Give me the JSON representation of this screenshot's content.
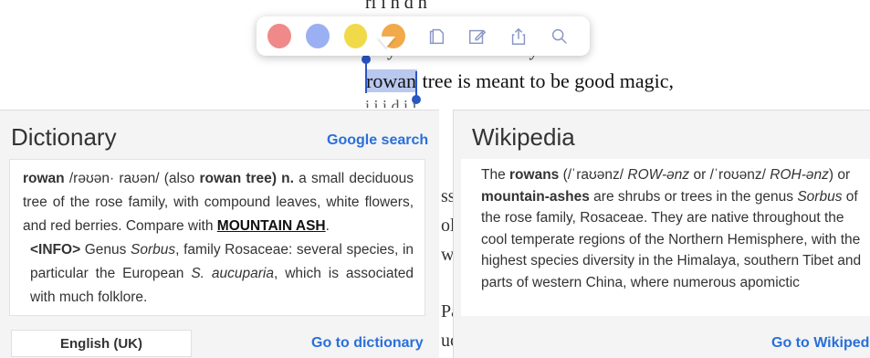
{
  "book": {
    "line_top_partial": "ri   i  h  d h",
    "line_1": "y mother used to say t",
    "line_2_selected": "rowan",
    "line_2_rest": " tree is meant to be good magic,",
    "line_3_partial": "i   i    i    d    i   i   "
  },
  "toolbar": {
    "colors": {
      "red": "#f08a8a",
      "blue": "#9ab0f2",
      "yellow": "#f1da4a",
      "orange": "#f2a94a"
    },
    "icons": [
      "copy-icon",
      "note-icon",
      "share-icon",
      "search-icon"
    ]
  },
  "gap_text": [
    "ss",
    "ol",
    "wo",
    "Pa",
    "uc"
  ],
  "dictionary": {
    "title": "Dictionary",
    "google_link": "Google search",
    "headword": "rowan",
    "pron": " /rəʊən· raʊən/ (also ",
    "variant": "rowan tree",
    "pos": ") n.",
    "definition": " a small deciduous tree of the rose family, with compound leaves, white flowers, and red berries. Compare with ",
    "xref": "MOUNTAIN ASH",
    "xref_after": ".",
    "info_label": "<INFO>",
    "info_text_1": " Genus ",
    "info_genus": "Sorbus",
    "info_text_2": ", family Rosaceae: several species, in particular the European ",
    "info_species": "S. aucuparia",
    "info_text_3": ", which is associated with much folklore.",
    "language": "English (UK)",
    "go_link": "Go to dictionary"
  },
  "wikipedia": {
    "title": "Wikipedia",
    "t1": "The ",
    "b1": "rowans",
    "t2": " (/ˈraʊənz/ ",
    "i1": "ROW-ənz",
    "t3": " or /ˈroʊənz/ ",
    "i2": "ROH-ənz",
    "t4": ") or ",
    "b2": "mountain-ashes",
    "t5": " are shrubs or trees in the genus ",
    "i3": "Sorbus",
    "t6": " of the rose family, Rosaceae. They are native throughout the cool temperate regions of the Northern Hemisphere, with the highest species diversity in the Himalaya, southern Tibet and parts of western China, where numerous apomictic",
    "go_link": "Go to Wikiped"
  }
}
